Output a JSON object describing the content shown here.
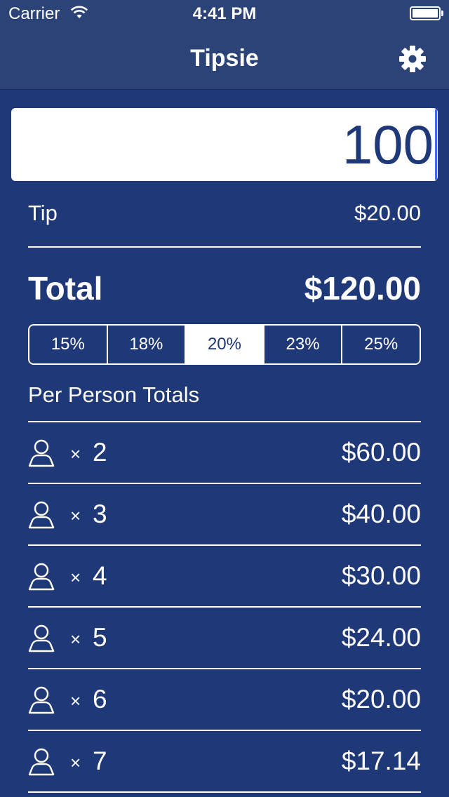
{
  "status_bar": {
    "carrier": "Carrier",
    "time": "4:41 PM",
    "wifi_icon": "wifi-icon",
    "battery_icon": "battery-icon"
  },
  "nav": {
    "title": "Tipsie",
    "settings_icon": "gear-icon"
  },
  "bill": {
    "amount": "100"
  },
  "tip": {
    "label": "Tip",
    "value": "$20.00"
  },
  "total": {
    "label": "Total",
    "value": "$120.00"
  },
  "tip_options": {
    "items": [
      "15%",
      "18%",
      "20%",
      "23%",
      "25%"
    ],
    "selected": "20%"
  },
  "per_person": {
    "heading": "Per Person Totals",
    "times_symbol": "×",
    "person_icon": "person-icon",
    "rows": [
      {
        "count": "2",
        "amount": "$60.00"
      },
      {
        "count": "3",
        "amount": "$40.00"
      },
      {
        "count": "4",
        "amount": "$30.00"
      },
      {
        "count": "5",
        "amount": "$24.00"
      },
      {
        "count": "6",
        "amount": "$20.00"
      },
      {
        "count": "7",
        "amount": "$17.14"
      }
    ]
  },
  "colors": {
    "background": "#1f3878",
    "nav_background": "#2c4378",
    "text": "#ffffff",
    "caret": "#3d6cf0"
  }
}
